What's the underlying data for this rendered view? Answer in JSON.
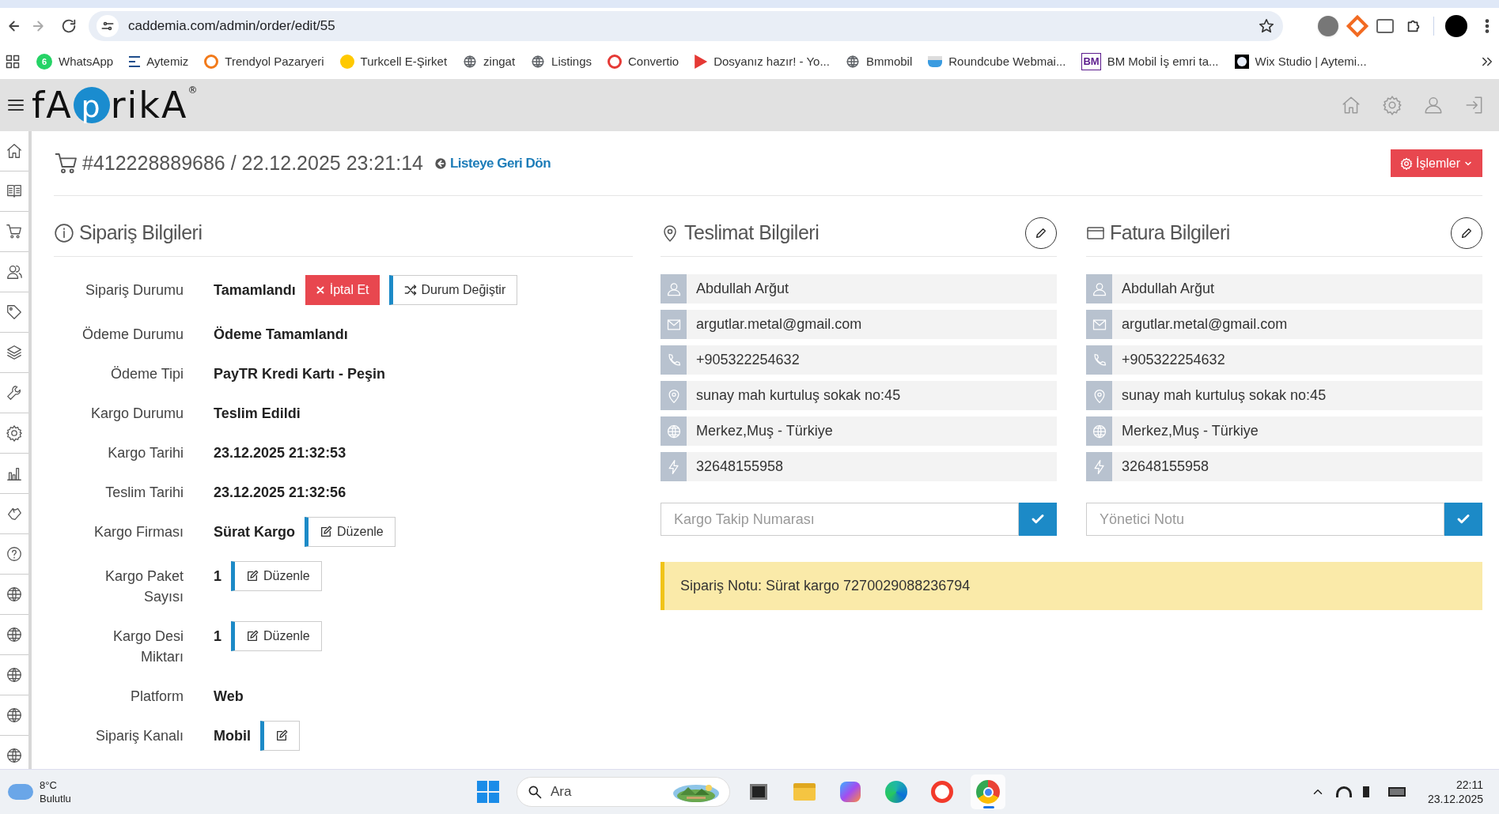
{
  "browser": {
    "url": "caddemia.com/admin/order/edit/55",
    "bookmarks": [
      {
        "label": "WhatsApp",
        "kind": "badge",
        "badge": "6",
        "color": "#25d366"
      },
      {
        "label": "Aytemiz",
        "kind": "lines",
        "color": "#1f4e8c"
      },
      {
        "label": "Trendyol Pazaryeri",
        "kind": "ring",
        "color": "#f27a1a"
      },
      {
        "label": "Turkcell E-Şirket",
        "kind": "dot",
        "color": "#ffc900"
      },
      {
        "label": "zingat",
        "kind": "globe",
        "color": "#5f6368"
      },
      {
        "label": "Listings",
        "kind": "globe",
        "color": "#5f6368"
      },
      {
        "label": "Convertio",
        "kind": "ring",
        "color": "#e53935"
      },
      {
        "label": "Dosyanız hazır! - Yo...",
        "kind": "flag",
        "color": "#e53935"
      },
      {
        "label": "Bmmobil",
        "kind": "globe",
        "color": "#5f6368"
      },
      {
        "label": "Roundcube Webmai...",
        "kind": "cube",
        "color": "#3a9be0"
      },
      {
        "label": "BM Mobil İş emri ta...",
        "kind": "text",
        "mark": "BM",
        "color": "#5b1a8c"
      },
      {
        "label": "Wix Studio | Aytemi...",
        "kind": "square",
        "color": "#000000"
      }
    ]
  },
  "app": {
    "logo": {
      "before": "fA",
      "circled": "p",
      "after": "rikA",
      "mark": "®"
    },
    "header_icons": [
      {
        "kind": "home"
      },
      {
        "kind": "gear"
      },
      {
        "kind": "user"
      },
      {
        "kind": "logout"
      }
    ],
    "sidebar": {
      "items": [
        {
          "kind": "home"
        },
        {
          "kind": "book"
        },
        {
          "kind": "cart"
        },
        {
          "kind": "users"
        },
        {
          "kind": "tag"
        },
        {
          "kind": "layers"
        },
        {
          "kind": "wrench"
        },
        {
          "kind": "gear"
        },
        {
          "kind": "chart"
        },
        {
          "kind": "hand"
        },
        {
          "kind": "question"
        },
        {
          "kind": "globe"
        },
        {
          "kind": "globe"
        },
        {
          "kind": "globe"
        },
        {
          "kind": "globe"
        },
        {
          "kind": "globe"
        }
      ]
    }
  },
  "order": {
    "title": "#412228889686 / 22.12.2025 23:21:14",
    "back_link": "Listeye Geri Dön",
    "actions_button": "İşlemler"
  },
  "order_info": {
    "title": "Sipariş Bilgileri",
    "fields": [
      {
        "label": "Sipariş Durumu",
        "value": "Tamamlandı",
        "buttons": [
          {
            "kind": "danger",
            "label": "İptal Et"
          },
          {
            "kind": "shuffle",
            "label": "Durum Değiştir"
          }
        ]
      },
      {
        "label": "Ödeme Durumu",
        "value": "Ödeme Tamamlandı"
      },
      {
        "label": "Ödeme Tipi",
        "value": "PayTR Kredi Kartı - Peşin"
      },
      {
        "label": "Kargo Durumu",
        "value": "Teslim Edildi"
      },
      {
        "label": "Kargo Tarihi",
        "value": "23.12.2025 21:32:53"
      },
      {
        "label": "Teslim Tarihi",
        "value": "23.12.2025 21:32:56"
      },
      {
        "label": "Kargo Firması",
        "value": "Sürat Kargo",
        "buttons": [
          {
            "kind": "edit",
            "label": "Düzenle"
          }
        ]
      },
      {
        "label": "Kargo Paket Sayısı",
        "value": "1",
        "buttons": [
          {
            "kind": "edit",
            "label": "Düzenle"
          }
        ]
      },
      {
        "label": "Kargo Desi Miktarı",
        "value": "1",
        "buttons": [
          {
            "kind": "edit",
            "label": "Düzenle"
          }
        ]
      },
      {
        "label": "Platform",
        "value": "Web"
      },
      {
        "label": "Sipariş Kanalı",
        "value": "Mobil",
        "buttons": [
          {
            "kind": "edit"
          }
        ]
      }
    ]
  },
  "addresses": [
    {
      "title": "Teslimat Bilgileri",
      "kind": "pin",
      "rows": [
        {
          "kind": "user",
          "text": "Abdullah Arğut"
        },
        {
          "kind": "mail",
          "text": "argutlar.metal@gmail.com"
        },
        {
          "kind": "phone",
          "text": "+905322254632"
        },
        {
          "kind": "pin",
          "text": "sunay mah kurtuluş sokak no:45"
        },
        {
          "kind": "globe",
          "text": "Merkez,Muş - Türkiye"
        },
        {
          "kind": "bolt",
          "text": "32648155958"
        }
      ],
      "input_placeholder": "Kargo Takip Numarası"
    },
    {
      "title": "Fatura Bilgileri",
      "kind": "card",
      "rows": [
        {
          "kind": "user",
          "text": "Abdullah Arğut"
        },
        {
          "kind": "mail",
          "text": "argutlar.metal@gmail.com"
        },
        {
          "kind": "phone",
          "text": "+905322254632"
        },
        {
          "kind": "pin",
          "text": "sunay mah kurtuluş sokak no:45"
        },
        {
          "kind": "globe",
          "text": "Merkez,Muş - Türkiye"
        },
        {
          "kind": "bolt",
          "text": "32648155958"
        }
      ],
      "input_placeholder": "Yönetici Notu"
    }
  ],
  "order_note": "Sipariş Notu: Sürat kargo 7270029088236794",
  "taskbar": {
    "weather": {
      "temp": "8°C",
      "condition": "Bulutlu"
    },
    "search_placeholder": "Ara",
    "apps": [
      {
        "kind": "windows",
        "selected": false
      },
      {
        "kind": "taskview",
        "selected": false
      },
      {
        "kind": "folder",
        "selected": false
      },
      {
        "kind": "copilot",
        "selected": false
      },
      {
        "kind": "edge",
        "selected": false
      },
      {
        "kind": "yandex",
        "selected": false
      },
      {
        "kind": "chrome",
        "selected": true
      }
    ],
    "time": "22:11",
    "date": "23.12.2025"
  }
}
